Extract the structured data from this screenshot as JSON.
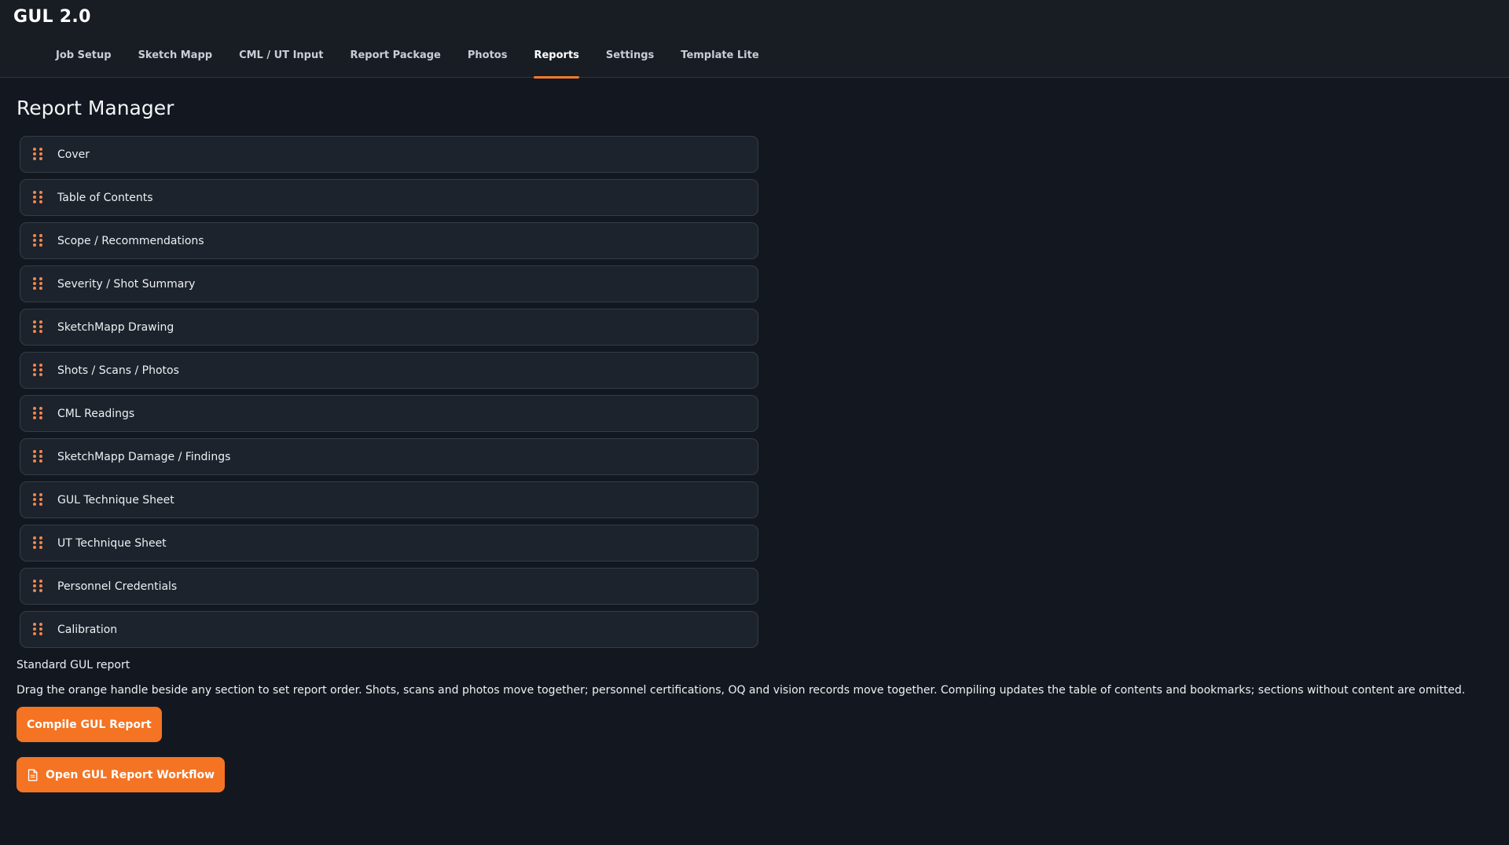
{
  "app": {
    "title": "GUL 2.0"
  },
  "nav": {
    "tabs": [
      {
        "label": "Job Setup",
        "active": false
      },
      {
        "label": "Sketch Mapp",
        "active": false
      },
      {
        "label": "CML / UT Input",
        "active": false
      },
      {
        "label": "Report Package",
        "active": false
      },
      {
        "label": "Photos",
        "active": false
      },
      {
        "label": "Reports",
        "active": true
      },
      {
        "label": "Settings",
        "active": false
      },
      {
        "label": "Template Lite",
        "active": false
      }
    ]
  },
  "main": {
    "title": "Report Manager",
    "sections": [
      {
        "label": "Cover"
      },
      {
        "label": "Table of Contents"
      },
      {
        "label": "Scope / Recommendations"
      },
      {
        "label": "Severity / Shot Summary"
      },
      {
        "label": "SketchMapp Drawing"
      },
      {
        "label": "Shots / Scans / Photos"
      },
      {
        "label": "CML Readings"
      },
      {
        "label": "SketchMapp Damage / Findings"
      },
      {
        "label": "GUL Technique Sheet"
      },
      {
        "label": "UT Technique Sheet"
      },
      {
        "label": "Personnel Credentials"
      },
      {
        "label": "Calibration"
      }
    ],
    "report_name": "Standard GUL report",
    "help_text": "Drag the orange handle beside any section to set report order. Shots, scans and photos move together; personnel certifications, OQ and vision records move together. Compiling updates the table of contents and bookmarks; sections without content are omitted.",
    "compile_button": "Compile GUL Report",
    "open_workflow_button": "Open GUL Report Workflow"
  },
  "colors": {
    "accent": "#f47424",
    "background": "#131820",
    "row_background": "#1c232c",
    "handle": "#f4854a"
  },
  "icons": {
    "drag_handle": "drag-handle-icon",
    "document": "document-icon"
  }
}
